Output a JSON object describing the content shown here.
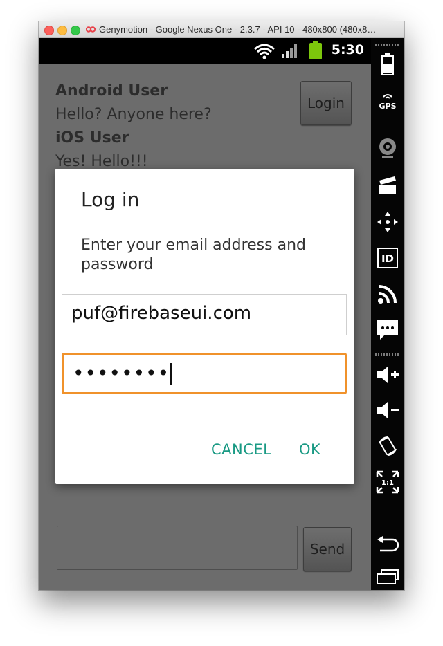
{
  "window": {
    "title": "Genymotion - Google Nexus One - 2.3.7 - API 10 - 480x800 (480x8…"
  },
  "statusbar": {
    "time": "5:30",
    "icons": [
      "wifi-icon",
      "signal-icon",
      "battery-icon"
    ]
  },
  "chat": {
    "messages": [
      {
        "name": "Android User",
        "text": "Hello? Anyone here?"
      },
      {
        "name": "iOS User",
        "text": "Yes! Hello!!!"
      }
    ],
    "login_label": "Login",
    "send_label": "Send",
    "compose_value": ""
  },
  "dialog": {
    "title": "Log in",
    "message": "Enter your email address and password",
    "email_value": "puf@firebaseui.com",
    "password_mask": "••••••••",
    "cancel_label": "CANCEL",
    "ok_label": "OK"
  },
  "side_controls": {
    "gps_label": "GPS",
    "id_label": "ID",
    "scale_label": "1:1",
    "items": [
      "battery-icon",
      "gps-icon",
      "webcam-icon",
      "capture-icon",
      "dpad-icon",
      "device-id-icon",
      "rss-icon",
      "sms-icon",
      "volume-up-icon",
      "volume-down-icon",
      "rotate-icon",
      "scale-icon",
      "back-icon",
      "recent-apps-icon"
    ]
  },
  "colors": {
    "accent": "#1a9a84",
    "focus_border": "#f0922b",
    "battery_green": "#7cc70c"
  }
}
